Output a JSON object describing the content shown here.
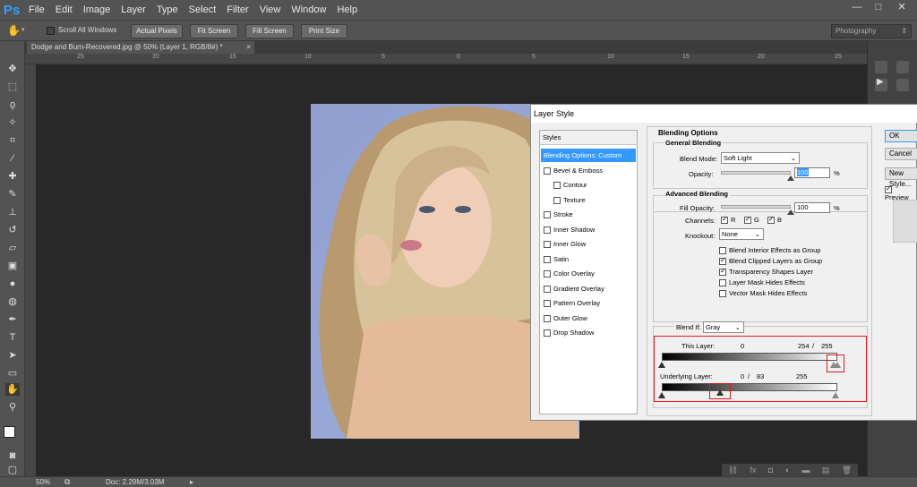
{
  "app": {
    "logo": "Ps",
    "menu": [
      "File",
      "Edit",
      "Image",
      "Layer",
      "Type",
      "Select",
      "Filter",
      "View",
      "Window",
      "Help"
    ],
    "window_controls": [
      "—",
      "□",
      "✕"
    ]
  },
  "options_bar": {
    "scroll_all_windows": "Scroll All Windows",
    "actual_pixels": "Actual Pixels",
    "fit_screen": "Fit Screen",
    "fill_screen": "Fill Screen",
    "print_size": "Print Size",
    "workspace": "Photography"
  },
  "document": {
    "tab_title": "Dodge and Burn-Recovered.jpg @ 50% (Layer 1, RGB/8#) *",
    "ruler_ticks": [
      "25",
      "20",
      "15",
      "10",
      "5",
      "0",
      "5",
      "10",
      "15",
      "20",
      "25"
    ]
  },
  "status_bar": {
    "zoom": "50%",
    "doc_info": "Doc: 2.29M/3.03M"
  },
  "dialog": {
    "title": "Layer Style",
    "styles_header": "Styles",
    "styles": [
      {
        "label": "Blending Options: Custom",
        "checkbox": false,
        "selected": true,
        "indent": false
      },
      {
        "label": "Bevel & Emboss",
        "checkbox": true,
        "checked": false,
        "indent": false
      },
      {
        "label": "Contour",
        "checkbox": true,
        "checked": false,
        "indent": true
      },
      {
        "label": "Texture",
        "checkbox": true,
        "checked": false,
        "indent": true
      },
      {
        "label": "Stroke",
        "checkbox": true,
        "checked": false,
        "indent": false
      },
      {
        "label": "Inner Shadow",
        "checkbox": true,
        "checked": false,
        "indent": false
      },
      {
        "label": "Inner Glow",
        "checkbox": true,
        "checked": false,
        "indent": false
      },
      {
        "label": "Satin",
        "checkbox": true,
        "checked": false,
        "indent": false
      },
      {
        "label": "Color Overlay",
        "checkbox": true,
        "checked": false,
        "indent": false
      },
      {
        "label": "Gradient Overlay",
        "checkbox": true,
        "checked": false,
        "indent": false
      },
      {
        "label": "Pattern Overlay",
        "checkbox": true,
        "checked": false,
        "indent": false
      },
      {
        "label": "Outer Glow",
        "checkbox": true,
        "checked": false,
        "indent": false
      },
      {
        "label": "Drop Shadow",
        "checkbox": true,
        "checked": false,
        "indent": false
      }
    ],
    "blending_options_title": "Blending Options",
    "general_blending_title": "General Blending",
    "blend_mode_label": "Blend Mode:",
    "blend_mode_value": "Soft Light",
    "opacity_label": "Opacity:",
    "opacity_value": "100",
    "opacity_level": 1.0,
    "percent": "%",
    "advanced_blending_title": "Advanced Blending",
    "fill_opacity_label": "Fill Opacity:",
    "fill_opacity_value": "100",
    "fill_opacity_level": 1.0,
    "channels_label": "Channels:",
    "channels": [
      {
        "label": "R",
        "checked": true
      },
      {
        "label": "G",
        "checked": true
      },
      {
        "label": "B",
        "checked": true
      }
    ],
    "knockout_label": "Knockout:",
    "knockout_value": "None",
    "advanced_checks": [
      {
        "label": "Blend Interior Effects as Group",
        "checked": false
      },
      {
        "label": "Blend Clipped Layers as Group",
        "checked": true
      },
      {
        "label": "Transparency Shapes Layer",
        "checked": true
      },
      {
        "label": "Layer Mask Hides Effects",
        "checked": false
      },
      {
        "label": "Vector Mask Hides Effects",
        "checked": false
      }
    ],
    "blend_if_label": "Blend If:",
    "blend_if_value": "Gray",
    "this_layer_label": "This Layer:",
    "this_layer_values": {
      "low": "0",
      "high_split": "254",
      "sep": "/",
      "high": "255"
    },
    "underlying_label": "Underlying Layer:",
    "underlying_values": {
      "low": "0",
      "sep": "/",
      "low_split": "83",
      "high": "255"
    },
    "buttons": {
      "ok": "OK",
      "cancel": "Cancel",
      "new_style": "New Style...",
      "preview": "Preview"
    },
    "preview_checked": true
  },
  "colors": {
    "selection": "#3399ff",
    "highlight_box": "#e21b1b",
    "ps_blue": "#32a0ff"
  }
}
